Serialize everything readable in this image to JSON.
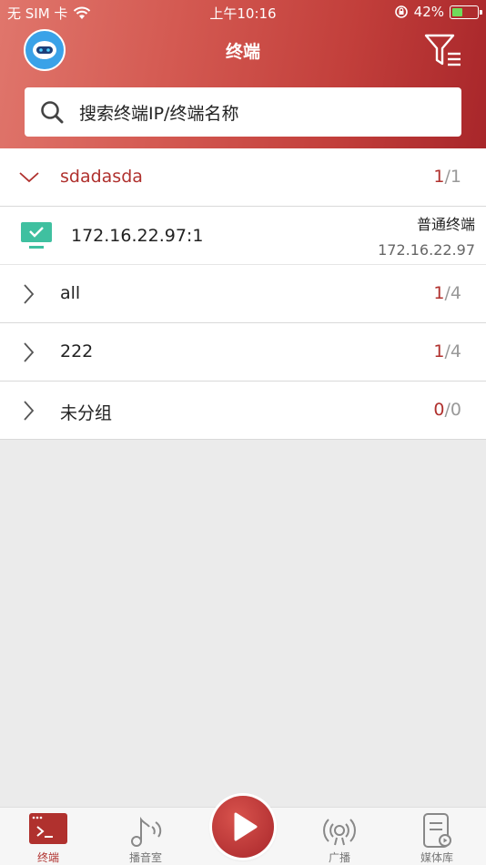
{
  "status_bar": {
    "carrier": "无 SIM 卡",
    "time": "上午10:16",
    "battery": "42%"
  },
  "nav": {
    "title": "终端"
  },
  "search": {
    "placeholder": "搜索终端IP/终端名称"
  },
  "groups": [
    {
      "name": "sdadasda",
      "online": "1",
      "total": "/1",
      "expanded": true
    },
    {
      "name": "all",
      "online": "1",
      "total": "/4",
      "expanded": false
    },
    {
      "name": "222",
      "online": "1",
      "total": "/4",
      "expanded": false
    },
    {
      "name": "未分组",
      "online": "0",
      "total": "/0",
      "expanded": false
    }
  ],
  "device": {
    "name": "172.16.22.97:1",
    "type": "普通终端",
    "ip": "172.16.22.97"
  },
  "tabs": [
    {
      "label": "终端",
      "icon": "terminal-icon",
      "active": true
    },
    {
      "label": "播音室",
      "icon": "music-note-icon",
      "active": false
    },
    {
      "label": "广播",
      "icon": "broadcast-icon",
      "active": false
    },
    {
      "label": "媒体库",
      "icon": "media-library-icon",
      "active": false
    }
  ],
  "colors": {
    "accent": "#b0312e",
    "device_icon": "#3fc0a0",
    "header_start": "#e0766c",
    "header_end": "#a8262a"
  }
}
